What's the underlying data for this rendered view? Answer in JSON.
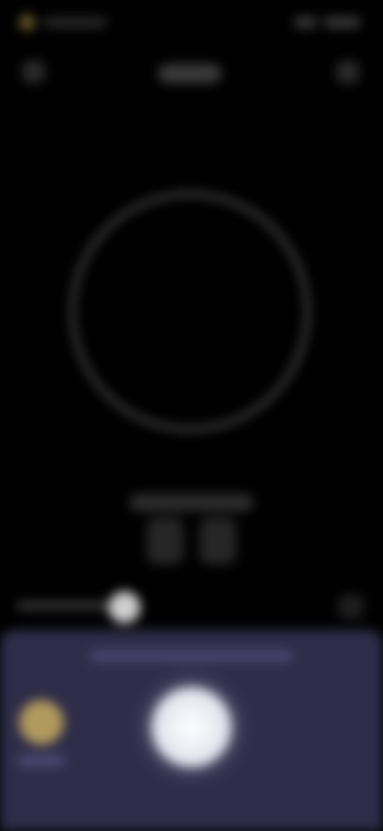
{
  "colors": {
    "background": "#000000",
    "ring": "#4a4a4a",
    "sheet": "#2e2c48",
    "record_button": "#e4e7ef",
    "left_icon": "#b29a5e"
  },
  "icons": {
    "status_left": "dot-icon",
    "top_left": "back-icon",
    "top_right": "menu-icon",
    "sheet_left": "circle-icon",
    "record": "record-icon",
    "slider_end": "end-icon"
  }
}
